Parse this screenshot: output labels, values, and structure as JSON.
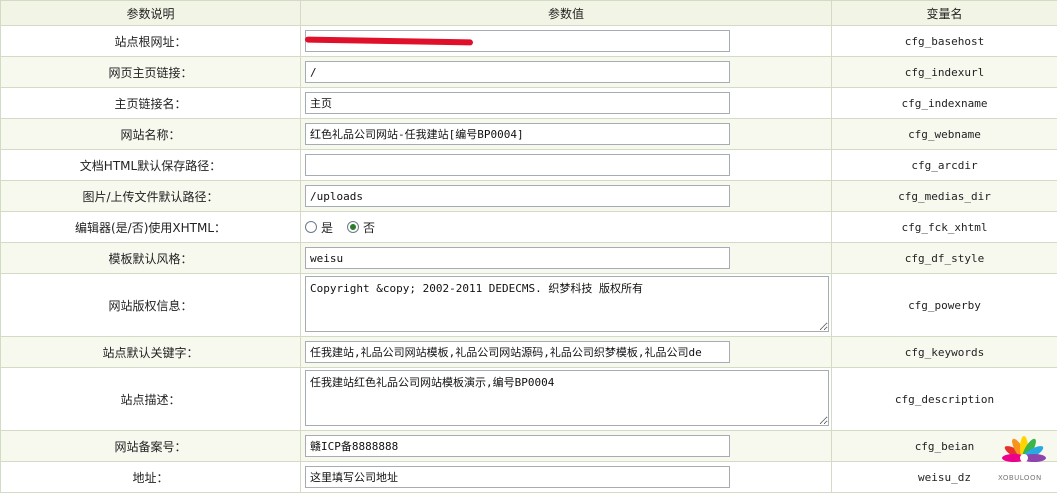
{
  "headers": {
    "description": "参数说明",
    "value": "参数值",
    "varname": "变量名"
  },
  "rows": [
    {
      "label": "站点根网址：",
      "value": "",
      "var": "cfg_basehost"
    },
    {
      "label": "网页主页链接：",
      "value": "/",
      "var": "cfg_indexurl"
    },
    {
      "label": "主页链接名：",
      "value": "主页",
      "var": "cfg_indexname"
    },
    {
      "label": "网站名称：",
      "value": "红色礼品公司网站-任我建站[编号BP0004]",
      "var": "cfg_webname"
    },
    {
      "label": "文档HTML默认保存路径：",
      "value": "",
      "var": "cfg_arcdir"
    },
    {
      "label": "图片/上传文件默认路径：",
      "value": "/uploads",
      "var": "cfg_medias_dir"
    },
    {
      "label": "编辑器(是/否)使用XHTML：",
      "radio_yes": "是",
      "radio_no": "否",
      "selected": "否",
      "var": "cfg_fck_xhtml"
    },
    {
      "label": "模板默认风格：",
      "value": "weisu",
      "var": "cfg_df_style"
    },
    {
      "label": "网站版权信息：",
      "value": "Copyright &copy; 2002-2011 DEDECMS. 织梦科技 版权所有",
      "var": "cfg_powerby"
    },
    {
      "label": "站点默认关键字：",
      "value": "任我建站,礼品公司网站模板,礼品公司网站源码,礼品公司织梦模板,礼品公司de",
      "var": "cfg_keywords"
    },
    {
      "label": "站点描述：",
      "value": "任我建站红色礼品公司网站模板演示,编号BP0004",
      "var": "cfg_description"
    },
    {
      "label": "网站备案号：",
      "value": "赣ICP备8888888",
      "var": "cfg_beian"
    },
    {
      "label": "地址：",
      "value": "这里填写公司地址",
      "var": "weisu_dz"
    }
  ],
  "watermark": {
    "text": "XOBULOON"
  },
  "colors": {
    "header_bg": "#f2f5e6",
    "row_alt_bg": "#f7f8ee",
    "border": "#d2dcc4",
    "redaction": "#e0102a"
  }
}
